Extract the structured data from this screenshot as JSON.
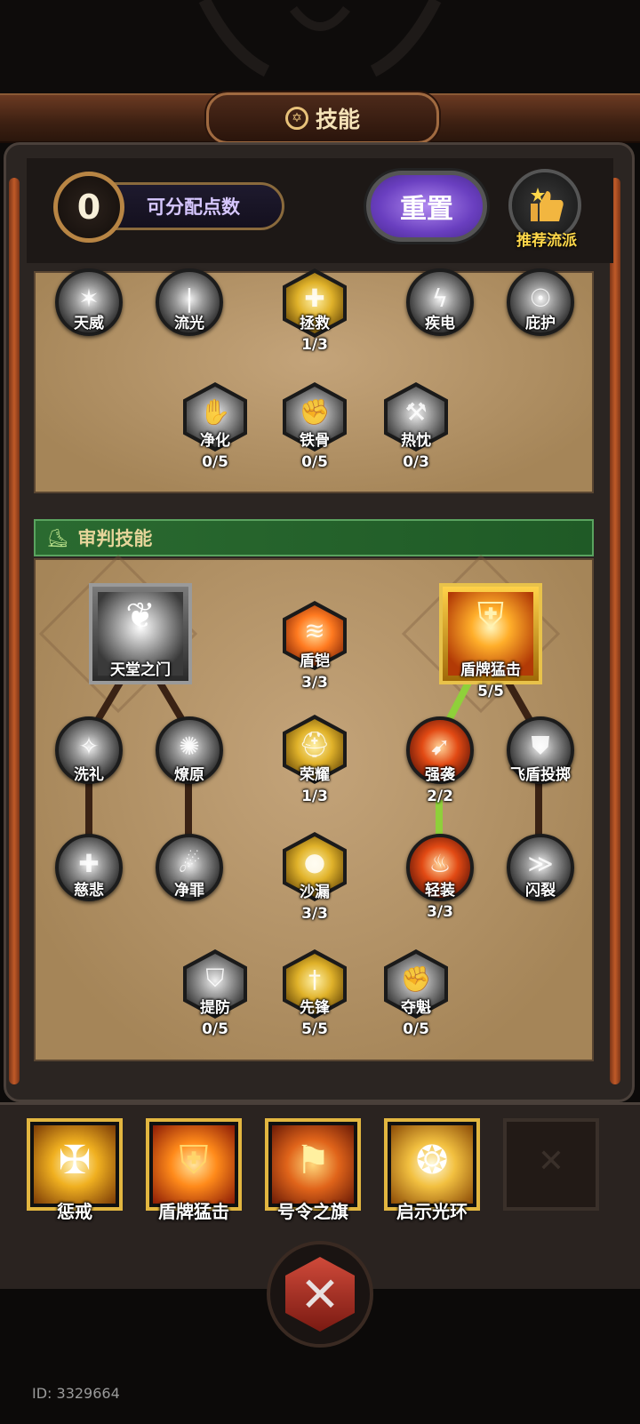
{
  "header": {
    "title": "技能",
    "title_icon": "pentagram-icon"
  },
  "points": {
    "value": "0",
    "label": "可分配点数"
  },
  "reset_button": {
    "label": "重置"
  },
  "recommend": {
    "label": "推荐流派",
    "icon": "thumbs-up-icon"
  },
  "upper_tree": {
    "row1": [
      {
        "name": "天威",
        "level": ""
      },
      {
        "name": "流光",
        "level": ""
      },
      {
        "name": "拯救",
        "level": "1/3"
      },
      {
        "name": "疾电",
        "level": ""
      },
      {
        "name": "庇护",
        "level": ""
      }
    ],
    "row2": [
      {
        "name": "净化",
        "level": "0/5"
      },
      {
        "name": "铁骨",
        "level": "0/5"
      },
      {
        "name": "热忱",
        "level": "0/3"
      }
    ]
  },
  "section": {
    "title": "审判技能",
    "icon": "boot-icon"
  },
  "judgment_tree": {
    "ultimates": [
      {
        "name": "天堂之门",
        "level": ""
      },
      {
        "name": "盾牌猛击",
        "level": "5/5"
      }
    ],
    "center": [
      {
        "name": "盾铠",
        "level": "3/3"
      },
      {
        "name": "荣耀",
        "level": "1/3"
      },
      {
        "name": "沙漏",
        "level": "3/3"
      }
    ],
    "row_a": [
      {
        "name": "洗礼",
        "level": ""
      },
      {
        "name": "燎原",
        "level": ""
      },
      {
        "name": "强袭",
        "level": "2/2"
      },
      {
        "name": "飞盾投掷",
        "level": ""
      }
    ],
    "row_b": [
      {
        "name": "慈悲",
        "level": ""
      },
      {
        "name": "净罪",
        "level": ""
      },
      {
        "name": "轻装",
        "level": "3/3"
      },
      {
        "name": "闪裂",
        "level": ""
      }
    ],
    "bottom": [
      {
        "name": "提防",
        "level": "0/5"
      },
      {
        "name": "先锋",
        "level": "5/5"
      },
      {
        "name": "夺魁",
        "level": "0/5"
      }
    ]
  },
  "equipped": [
    {
      "name": "惩戒"
    },
    {
      "name": "盾牌猛击"
    },
    {
      "name": "号令之旗"
    },
    {
      "name": "启示光环"
    },
    {
      "name": ""
    }
  ],
  "footer": {
    "id_text": "ID: 3329664",
    "close_icon": "crossed-swords-close-icon"
  },
  "colors": {
    "accent_gold": "#e2b640",
    "section_green": "#2a6a30",
    "reset_purple": "#6a3fc0",
    "link_green": "#8fd03a",
    "link_brown": "#3a2214"
  }
}
